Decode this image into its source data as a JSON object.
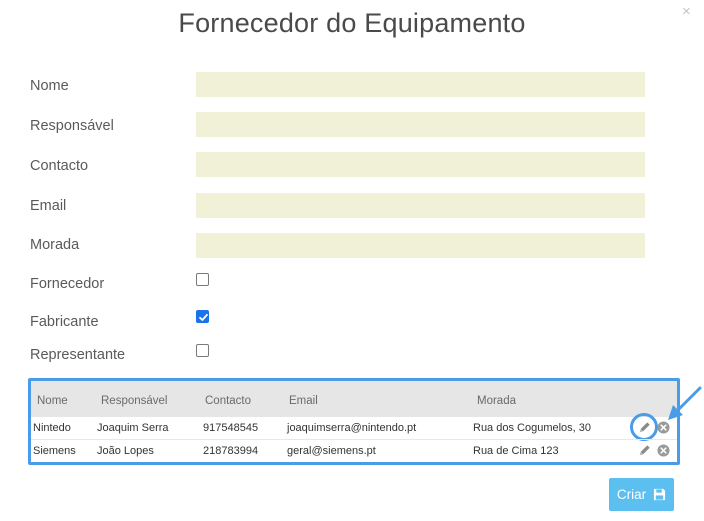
{
  "dialog": {
    "title": "Fornecedor do Equipamento",
    "close_glyph": "×"
  },
  "form": {
    "fields": [
      {
        "label": "Nome",
        "value": ""
      },
      {
        "label": "Responsável",
        "value": ""
      },
      {
        "label": "Contacto",
        "value": ""
      },
      {
        "label": "Email",
        "value": ""
      },
      {
        "label": "Morada",
        "value": ""
      }
    ],
    "checkboxes": [
      {
        "label": "Fornecedor",
        "checked": false
      },
      {
        "label": "Fabricante",
        "checked": true
      },
      {
        "label": "Representante",
        "checked": false
      }
    ]
  },
  "table": {
    "columns": [
      "Nome",
      "Responsável",
      "Contacto",
      "Email",
      "Morada"
    ],
    "rows": [
      {
        "nome": "Nintedo",
        "responsavel": "Joaquim Serra",
        "contacto": "917548545",
        "email": "joaquimserra@nintendo.pt",
        "morada": "Rua dos Cogumelos, 30"
      },
      {
        "nome": "Siemens",
        "responsavel": "João Lopes",
        "contacto": "218783994",
        "email": "geral@siemens.pt",
        "morada": "Rua de Cima 123"
      }
    ],
    "row_actions": [
      "pencil-icon",
      "circle-x-icon"
    ]
  },
  "actions": {
    "create_label": "Criar",
    "create_icon": "floppy-disk-icon"
  },
  "colors": {
    "input_bg": "#f0f1d7",
    "highlight": "#4a9be8",
    "button": "#5bc0f0",
    "checkbox_checked": "#1a73e8"
  }
}
